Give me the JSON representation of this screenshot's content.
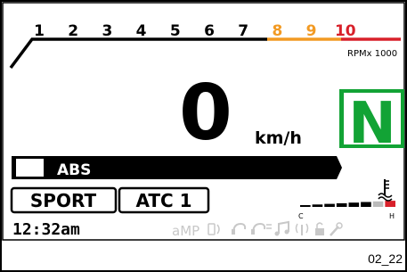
{
  "tachometer": {
    "ticks": [
      {
        "label": "1",
        "color": "#000000"
      },
      {
        "label": "2",
        "color": "#000000"
      },
      {
        "label": "3",
        "color": "#000000"
      },
      {
        "label": "4",
        "color": "#000000"
      },
      {
        "label": "5",
        "color": "#000000"
      },
      {
        "label": "6",
        "color": "#000000"
      },
      {
        "label": "7",
        "color": "#000000"
      },
      {
        "label": "8",
        "color": "#f29a23"
      },
      {
        "label": "9",
        "color": "#f29a23"
      },
      {
        "label": "10",
        "color": "#d8202a"
      }
    ],
    "unit_label": "RPMx 1000"
  },
  "speed": {
    "value": "0",
    "unit": "km/h"
  },
  "gear": {
    "value": "N",
    "color": "#12a335"
  },
  "abs": {
    "label": "ABS"
  },
  "mode": {
    "label": "SPORT"
  },
  "traction": {
    "label": "ATC 1"
  },
  "clock": {
    "time": "12:32am"
  },
  "temperature": {
    "cold_label": "C",
    "hot_label": "H",
    "level_fraction": 0.78
  },
  "indicators": {
    "amp_label": "aMP"
  },
  "caption": "02_22"
}
